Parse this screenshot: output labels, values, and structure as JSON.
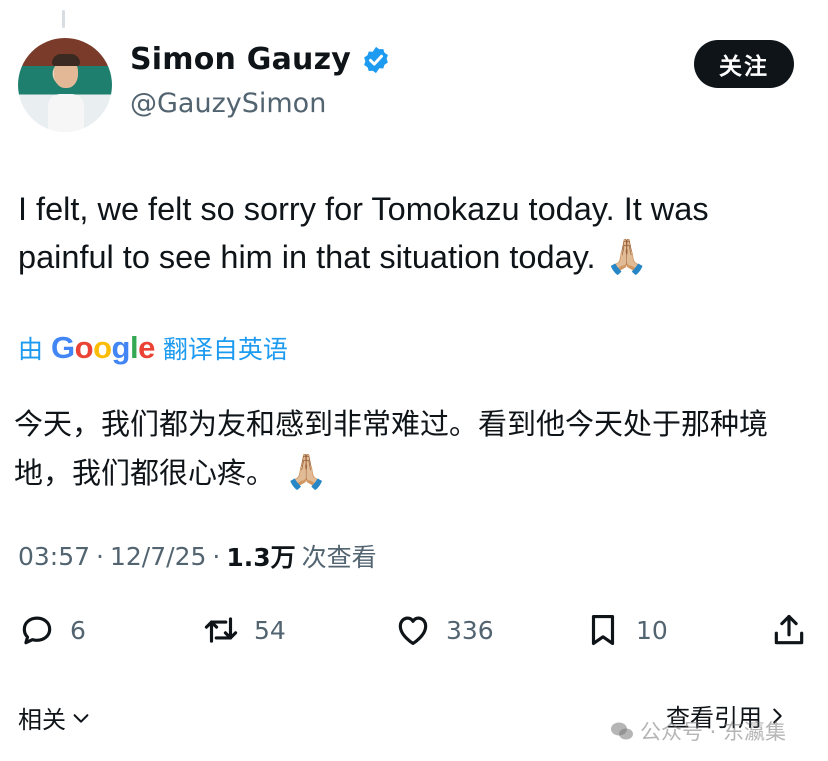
{
  "user": {
    "display_name": "Simon Gauzy",
    "handle": "@GauzySimon",
    "verified_icon": "verified-badge-icon"
  },
  "follow_button": {
    "label": "关注"
  },
  "tweet": {
    "text": "I felt, we felt so sorry for Tomokazu today. It was painful to see him in that situation today.",
    "emoji": "🙏🏼"
  },
  "translation": {
    "prefix": "由",
    "provider": "Google",
    "suffix": "翻译自英语",
    "text": "今天，我们都为友和感到非常难过。看到他今天处于那种境地，我们都很心疼。",
    "emoji": "🙏🏼"
  },
  "meta": {
    "time": "03:57",
    "separator1": "·",
    "date": "12/7/25",
    "separator2": "·",
    "views_count": "1.3万",
    "views_label": "次查看"
  },
  "actions": {
    "replies": "6",
    "retweets": "54",
    "likes": "336",
    "bookmarks": "10"
  },
  "footer": {
    "related_label": "相关",
    "quotes_label": "查看引用"
  },
  "watermark": {
    "text": "公众号 · 东瀛集"
  }
}
